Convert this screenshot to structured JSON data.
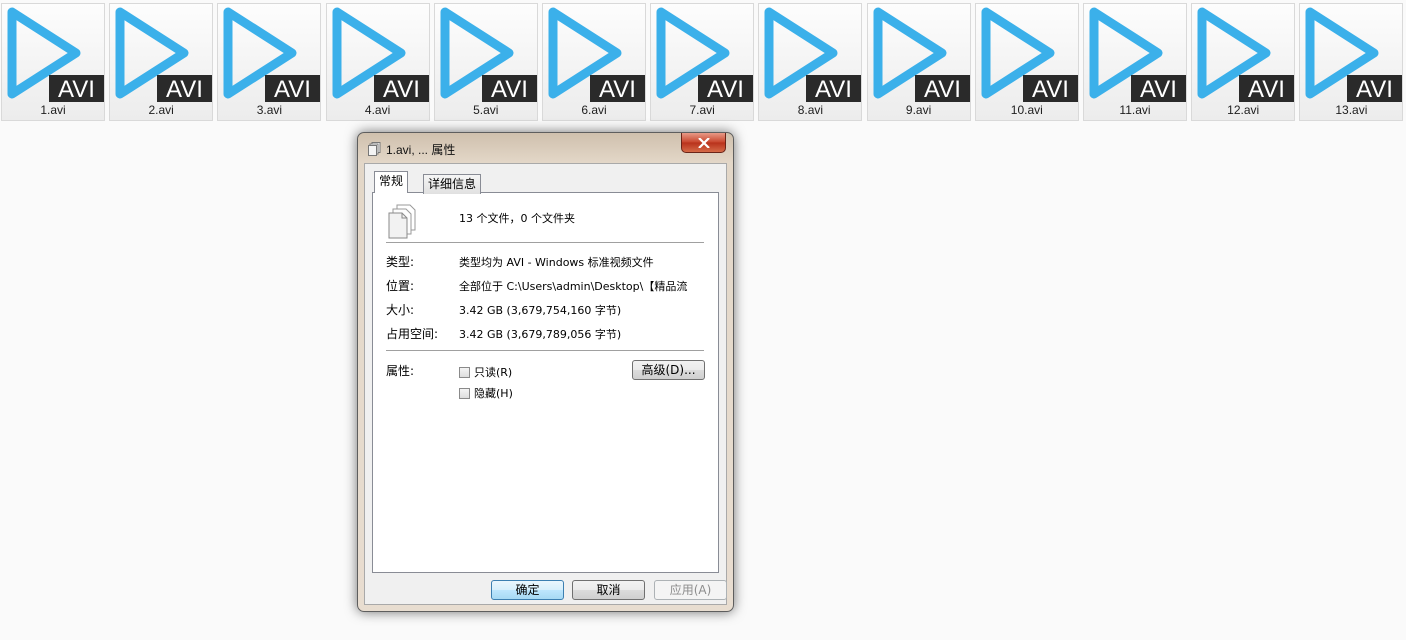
{
  "files": [
    {
      "name": "1.avi",
      "badge": "AVI"
    },
    {
      "name": "2.avi",
      "badge": "AVI"
    },
    {
      "name": "3.avi",
      "badge": "AVI"
    },
    {
      "name": "4.avi",
      "badge": "AVI"
    },
    {
      "name": "5.avi",
      "badge": "AVI"
    },
    {
      "name": "6.avi",
      "badge": "AVI"
    },
    {
      "name": "7.avi",
      "badge": "AVI"
    },
    {
      "name": "8.avi",
      "badge": "AVI"
    },
    {
      "name": "9.avi",
      "badge": "AVI"
    },
    {
      "name": "10.avi",
      "badge": "AVI"
    },
    {
      "name": "11.avi",
      "badge": "AVI"
    },
    {
      "name": "12.avi",
      "badge": "AVI"
    },
    {
      "name": "13.avi",
      "badge": "AVI"
    }
  ],
  "colors": {
    "play_icon": "#3bb0ea",
    "badge_bg": "#2a2a2a",
    "badge_text": "#ffffff"
  },
  "dialog": {
    "title": "1.avi, ... 属性",
    "titlebar_icon": "multi-file-icon",
    "close_icon": "close-icon",
    "tabs": [
      {
        "label": "常规",
        "active": true
      },
      {
        "label": "详细信息",
        "active": false
      }
    ],
    "summary": "13 个文件，0 个文件夹",
    "props": [
      {
        "label": "类型:",
        "value": "类型均为 AVI - Windows 标准视频文件"
      },
      {
        "label": "位置:",
        "value": "全部位于 C:\\Users\\admin\\Desktop\\【精品流"
      },
      {
        "label": "大小:",
        "value": "3.42 GB (3,679,754,160 字节)"
      },
      {
        "label": "占用空间:",
        "value": "3.42 GB (3,679,789,056 字节)"
      }
    ],
    "attributes_label": "属性:",
    "readonly_label": "只读(R)",
    "readonly_checked": false,
    "hidden_label": "隐藏(H)",
    "hidden_checked": false,
    "advanced_button": "高级(D)...",
    "ok_button": "确定",
    "cancel_button": "取消",
    "apply_button": "应用(A)"
  }
}
